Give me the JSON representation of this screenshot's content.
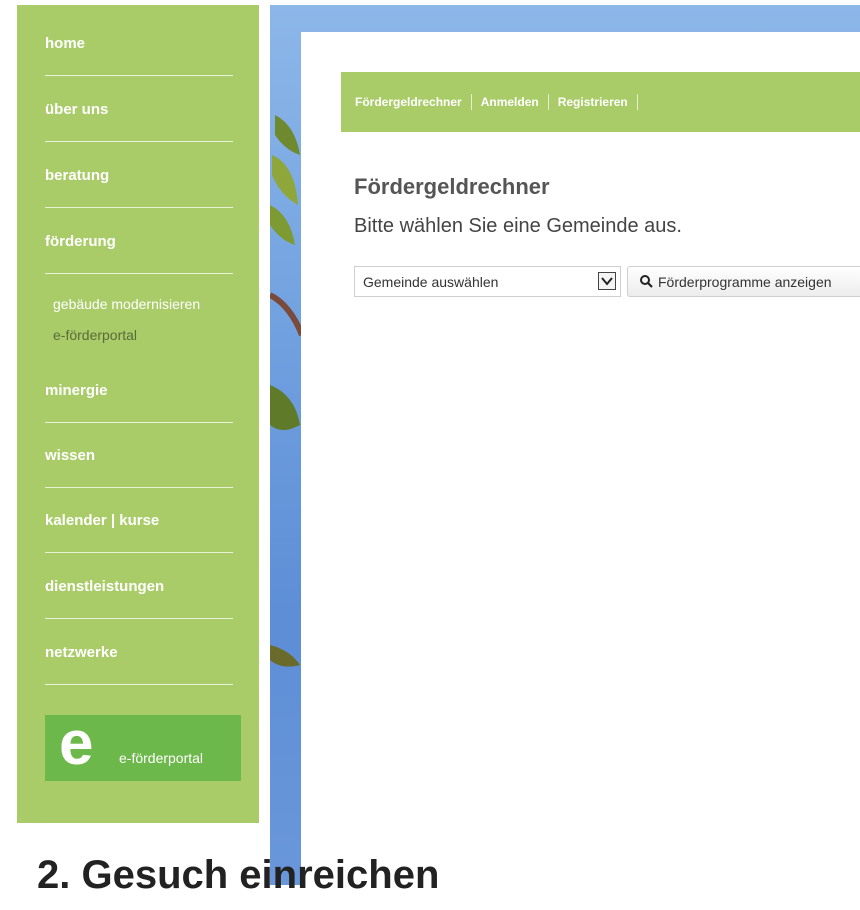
{
  "sidebar": {
    "items": [
      {
        "label": "home"
      },
      {
        "label": "über uns"
      },
      {
        "label": "beratung"
      },
      {
        "label": "förderung"
      },
      {
        "label": "minergie"
      },
      {
        "label": "wissen"
      },
      {
        "label": "kalender | kurse"
      },
      {
        "label": "dienstleistungen"
      },
      {
        "label": "netzwerke"
      }
    ],
    "subitems": [
      {
        "label": "gebäude modernisieren"
      },
      {
        "label": "e-förderportal"
      }
    ],
    "portal": {
      "letter": "e",
      "label": "e-förderportal"
    }
  },
  "topnav": {
    "links": [
      {
        "label": "Fördergeldrechner"
      },
      {
        "label": "Anmelden"
      },
      {
        "label": "Registrieren"
      }
    ]
  },
  "main": {
    "title": "Fördergeldrechner",
    "subtitle": "Bitte wählen Sie eine Gemeinde aus.",
    "select_value": "Gemeinde auswählen",
    "button_label": "Förderprogramme anzeigen"
  },
  "footer": {
    "heading": "2. Gesuch einreichen"
  },
  "colors": {
    "sidebar_green": "#a9cc69",
    "portal_green": "#6db84a",
    "sky_blue": "#6f9fdf"
  }
}
